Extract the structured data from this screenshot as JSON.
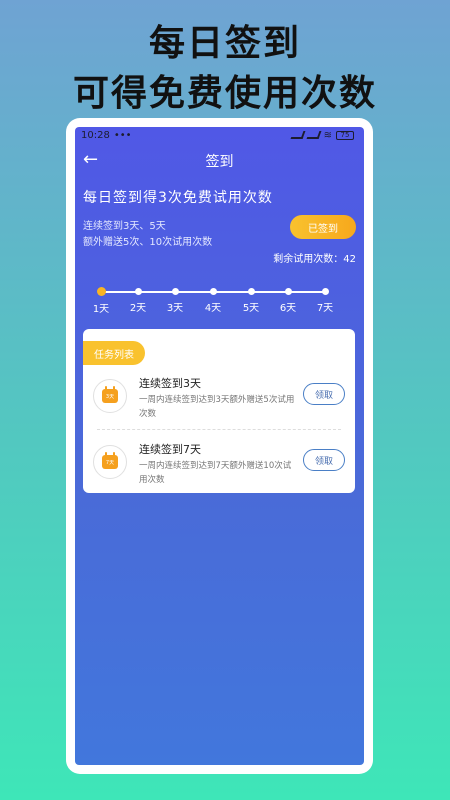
{
  "promo": {
    "line1": "每日签到",
    "line2": "可得免费使用次数"
  },
  "status": {
    "time": "10:28",
    "battery": "75"
  },
  "header": {
    "title": "签到"
  },
  "main": {
    "headline": "每日签到得3次免费试用次数",
    "desc1": "连续签到3天、5天",
    "desc2": "额外赠送5次、10次试用次数",
    "signed_label": "已签到",
    "remaining_label": "剩余试用次数：42"
  },
  "timeline": {
    "days": [
      "1天",
      "2天",
      "3天",
      "4天",
      "5天",
      "6天",
      "7天"
    ],
    "completed": 1
  },
  "tasks": {
    "tag": "任务列表",
    "items": [
      {
        "title": "连续签到3天",
        "desc": "一周内连续签到达到3天额外赠送5次试用次数",
        "icon_text": "3天",
        "button": "领取"
      },
      {
        "title": "连续签到7天",
        "desc": "一周内连续签到达到7天额外赠送10次试用次数",
        "icon_text": "7天",
        "button": "领取"
      }
    ]
  },
  "colors": {
    "accent": "#f9c22e",
    "primary": "#4f5fe3"
  }
}
